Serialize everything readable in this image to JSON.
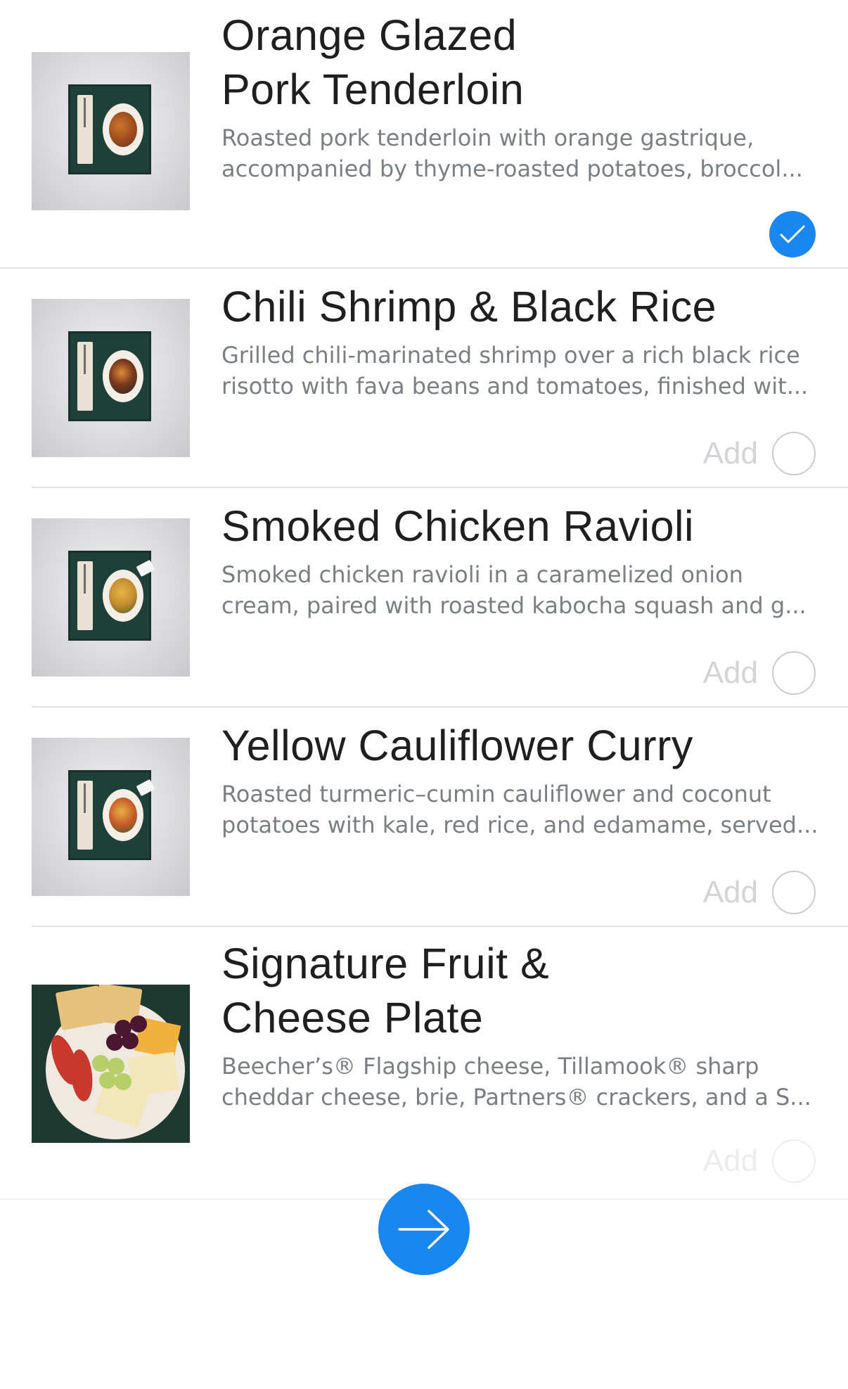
{
  "menu": {
    "items": [
      {
        "title_lines": [
          "Orange Glazed",
          "Pork Tenderloin"
        ],
        "description_lines": [
          "Roasted pork tenderloin with orange gastrique,",
          "accompanied by thyme-roasted potatoes, broccol..."
        ],
        "selected": true,
        "image": "meal-tray-photo"
      },
      {
        "title_lines": [
          "Chili Shrimp & Black Rice"
        ],
        "description_lines": [
          "Grilled chili-marinated shrimp over a rich black rice",
          "risotto with fava beans and tomatoes, finished wit..."
        ],
        "add_label": "Add",
        "selected": false,
        "image": "meal-tray-photo"
      },
      {
        "title_lines": [
          "Smoked Chicken Ravioli"
        ],
        "description_lines": [
          "Smoked chicken ravioli in a caramelized onion",
          "cream, paired with roasted kabocha squash and g..."
        ],
        "add_label": "Add",
        "selected": false,
        "image": "meal-tray-photo"
      },
      {
        "title_lines": [
          "Yellow Cauliflower Curry"
        ],
        "description_lines": [
          "Roasted turmeric–cumin cauliflower and coconut",
          "potatoes with kale, red rice, and edamame, served..."
        ],
        "add_label": "Add",
        "selected": false,
        "image": "meal-tray-photo"
      },
      {
        "title_lines": [
          "Signature Fruit &",
          "Cheese Plate"
        ],
        "description_lines": [
          "Beecher’s® Flagship cheese, Tillamook® sharp",
          "cheddar cheese, brie, Partners® crackers, and a S..."
        ],
        "add_label": "Add",
        "selected": false,
        "image": "fruit-cheese-photo"
      }
    ]
  },
  "next_button": {
    "icon": "arrow-right-icon"
  },
  "colors": {
    "accent": "#1a86f0",
    "title_text": "#1f1f1f",
    "description_text": "#7a7f85",
    "add_label": "#d2d4d7",
    "divider": "#e3e3e3"
  }
}
